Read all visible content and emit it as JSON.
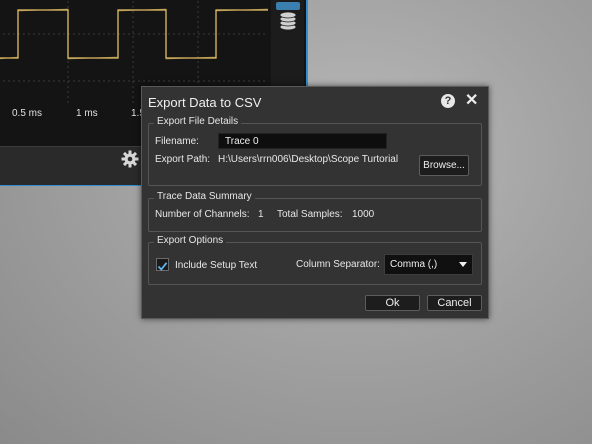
{
  "scope": {
    "time_ticks": [
      "0.5 ms",
      "1 ms",
      "1.5"
    ]
  },
  "dialog": {
    "title": "Export Data to CSV",
    "file_details": {
      "group_title": "Export File Details",
      "filename_label": "Filename:",
      "filename_value": "Trace 0",
      "path_label": "Export Path:",
      "path_value": "H:\\Users\\rrn006\\Desktop\\Scope Turtorial",
      "browse_label": "Browse..."
    },
    "summary": {
      "group_title": "Trace Data Summary",
      "channels_label": "Number of Channels:",
      "channels_value": "1",
      "samples_label": "Total Samples:",
      "samples_value": "1000"
    },
    "options": {
      "group_title": "Export Options",
      "include_setup_label": "Include Setup Text",
      "include_setup_checked": true,
      "separator_label": "Column Separator:",
      "separator_value": "Comma (,)"
    },
    "ok_label": "Ok",
    "cancel_label": "Cancel"
  },
  "colors": {
    "accent": "#2f8fd0",
    "trace": "#e8c46a",
    "checkmark": "#5fb4ee"
  },
  "icons": [
    "gear-icon",
    "layers-icon",
    "help-icon",
    "close-icon",
    "check-icon",
    "chevron-down-icon"
  ]
}
